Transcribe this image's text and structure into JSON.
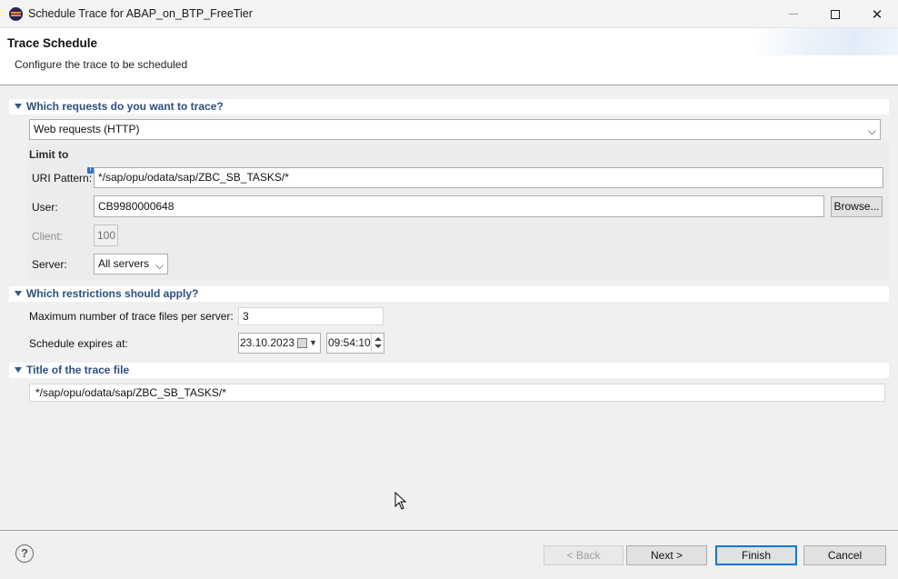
{
  "window": {
    "title": "Schedule Trace for ABAP_on_BTP_FreeTier",
    "minimize_glyph": "—",
    "maximize_glyph": "□",
    "close_glyph": "✕"
  },
  "header": {
    "title": "Trace Schedule",
    "subtitle": "Configure the trace to be scheduled"
  },
  "section_requests": {
    "title": "Which requests do you want to trace?",
    "request_type": "Web requests (HTTP)",
    "limit_to_label": "Limit to",
    "uri_pattern_label": "URI Pattern:",
    "uri_pattern_value": "*/sap/opu/odata/sap/ZBC_SB_TASKS/*",
    "user_label": "User:",
    "user_value": "CB9980000648",
    "browse_label": "Browse...",
    "client_label": "Client:",
    "client_value": "100",
    "server_label": "Server:",
    "server_value": "All servers"
  },
  "section_restrictions": {
    "title": "Which restrictions should apply?",
    "max_files_label": "Maximum number of trace files per server:",
    "max_files_value": "3",
    "expires_label": "Schedule expires at:",
    "expires_date": "23.10.2023",
    "expires_time": "09:54:10"
  },
  "section_title": {
    "title": "Title of the trace file",
    "value": "*/sap/opu/odata/sap/ZBC_SB_TASKS/*"
  },
  "footer": {
    "help_glyph": "?",
    "back_label": "< Back",
    "next_label": "Next >",
    "finish_label": "Finish",
    "cancel_label": "Cancel"
  },
  "icons": {
    "app": "eclipse-icon",
    "expand": "triangle-down-icon",
    "dropdown": "chevron-down-icon",
    "calendar": "calendar-icon",
    "help": "help-icon",
    "info": "info-icon"
  }
}
